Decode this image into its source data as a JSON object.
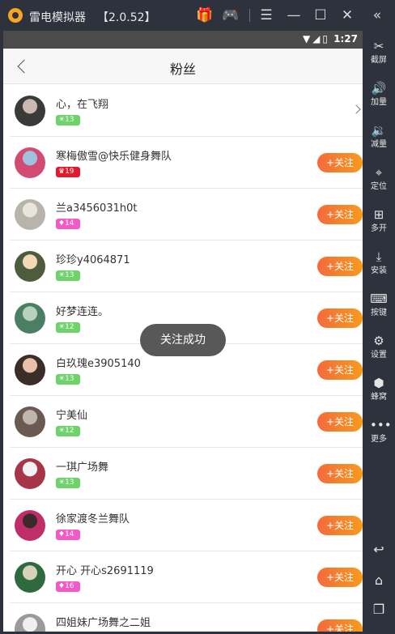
{
  "window": {
    "title": "雷电模拟器",
    "version": "【2.0.52】"
  },
  "statusbar": {
    "time": "1:27",
    "icons": "▼◢▯"
  },
  "header": {
    "title": "粉丝"
  },
  "users": [
    {
      "name": "心，在飞翔",
      "level": "13",
      "badge": "green",
      "action": "chevron"
    },
    {
      "name": "寒梅傲雪@快乐健身舞队",
      "level": "19",
      "badge": "red",
      "action": "follow"
    },
    {
      "name": "兰a3456031h0t",
      "level": "14",
      "badge": "pink",
      "action": "follow"
    },
    {
      "name": "珍珍y4064871",
      "level": "13",
      "badge": "green",
      "action": "follow"
    },
    {
      "name": "好梦连连。",
      "level": "12",
      "badge": "green",
      "action": "follow"
    },
    {
      "name": "白玖瑰e3905140",
      "level": "13",
      "badge": "green",
      "action": "follow"
    },
    {
      "name": "宁美仙",
      "level": "12",
      "badge": "green",
      "action": "follow"
    },
    {
      "name": "一琪广场舞",
      "level": "13",
      "badge": "green",
      "action": "follow"
    },
    {
      "name": "徐家渡冬兰舞队",
      "level": "14",
      "badge": "pink",
      "action": "follow"
    },
    {
      "name": "开心 开心s2691119",
      "level": "16",
      "badge": "pink",
      "action": "follow"
    },
    {
      "name": "四姐妹广场舞之二姐",
      "level": "",
      "badge": "",
      "action": "follow"
    }
  ],
  "follow_label": "+关注",
  "toast": "关注成功",
  "sidebar": {
    "screenshot": "截屏",
    "volume_up": "加量",
    "volume_down": "减量",
    "location": "定位",
    "multi": "多开",
    "install": "安装",
    "keys": "按键",
    "settings": "设置",
    "hive": "蜂窝",
    "more": "更多"
  },
  "colors": {
    "accent_orange": "#f36a3c",
    "badge_green": "#6fd36a",
    "badge_pink": "#f25bc7",
    "badge_red": "#e4192c"
  }
}
